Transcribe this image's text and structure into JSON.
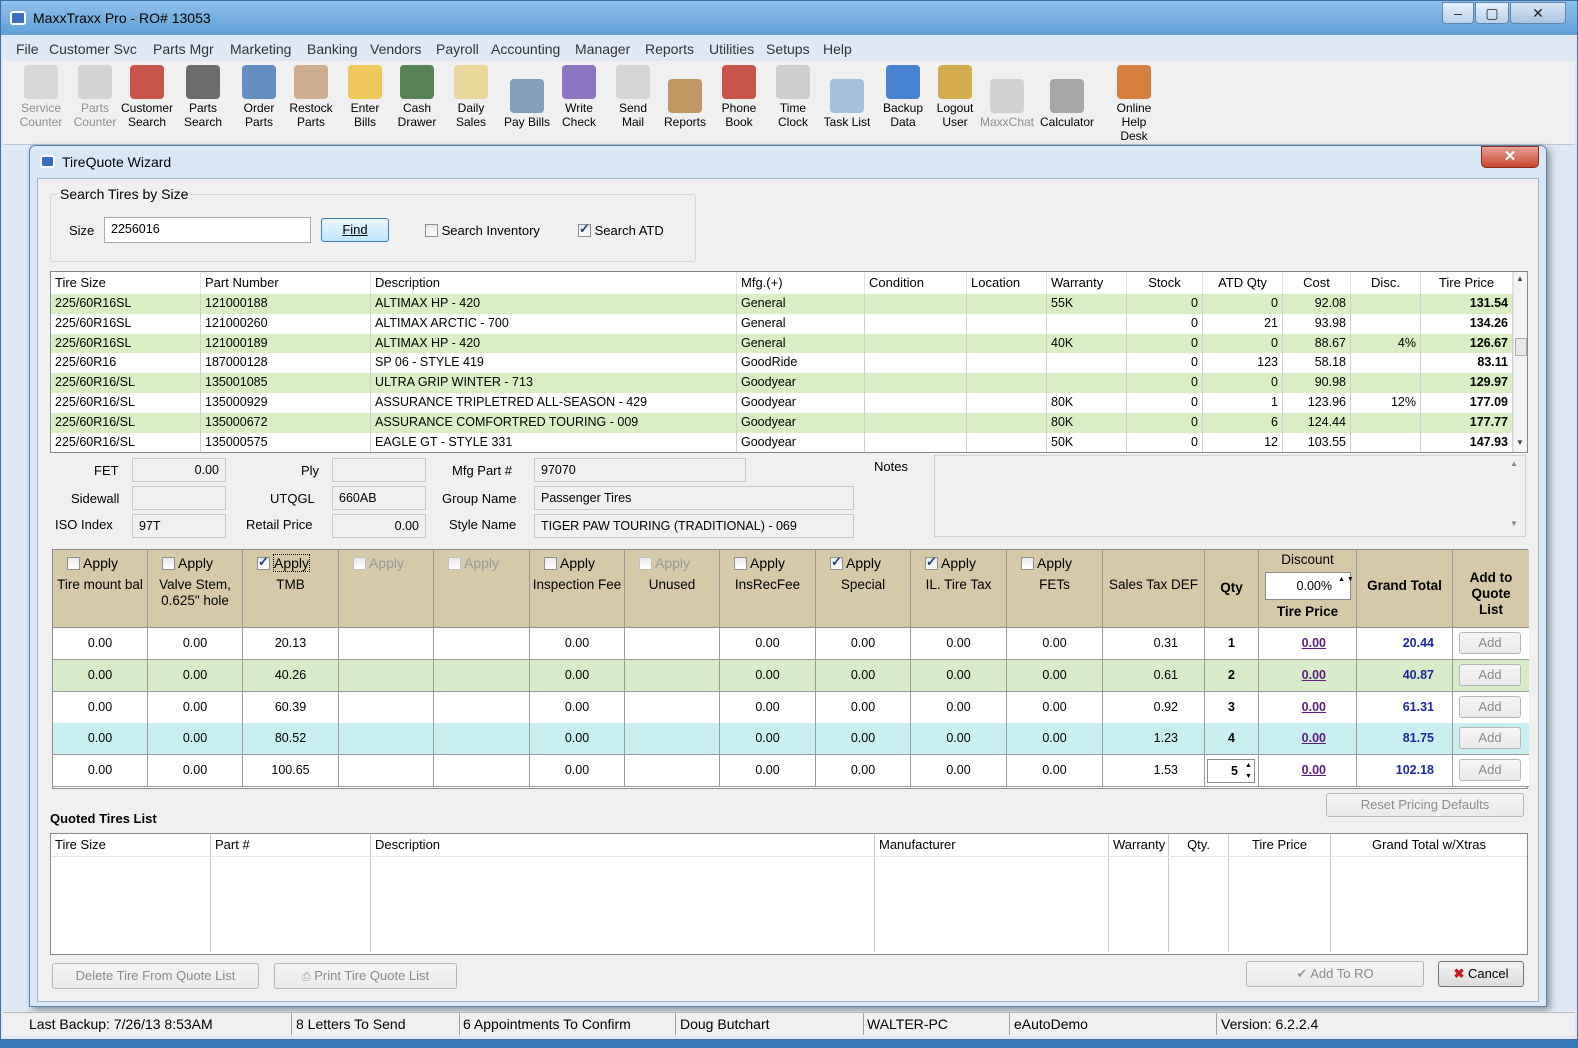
{
  "window": {
    "title": "MaxxTraxx Pro  - RO# 13053"
  },
  "menu": [
    "File",
    "Customer Svc",
    "Parts Mgr",
    "Marketing",
    "Banking",
    "Vendors",
    "Payroll",
    "Accounting",
    "Manager",
    "Reports",
    "Utilities",
    "Setups",
    "Help"
  ],
  "toolbar": [
    {
      "label": "Service\nCounter",
      "icon": "service-counter-icon",
      "enabled": false
    },
    {
      "label": "Parts\nCounter",
      "icon": "parts-counter-icon",
      "enabled": false
    },
    {
      "label": "Customer\nSearch",
      "icon": "car-icon",
      "enabled": true
    },
    {
      "label": "Parts\nSearch",
      "icon": "tire-icon",
      "enabled": true
    },
    {
      "label": "Order\nParts",
      "icon": "order-icon",
      "enabled": true
    },
    {
      "label": "Restock\nParts",
      "icon": "clipboard-icon",
      "enabled": true
    },
    {
      "label": "Enter\nBills",
      "icon": "bills-icon",
      "enabled": true
    },
    {
      "label": "Cash\nDrawer",
      "icon": "money-bag-icon",
      "enabled": true
    },
    {
      "label": "Daily\nSales",
      "icon": "notepad-icon",
      "enabled": true
    },
    {
      "label": "Pay Bills",
      "icon": "register-icon",
      "enabled": true
    },
    {
      "label": "Write\nCheck",
      "icon": "check-icon",
      "enabled": true
    },
    {
      "label": "Send\nMail",
      "icon": "mail-icon",
      "enabled": true
    },
    {
      "label": "Reports",
      "icon": "reports-icon",
      "enabled": true
    },
    {
      "label": "Phone\nBook",
      "icon": "phone-icon",
      "enabled": true
    },
    {
      "label": "Time\nClock",
      "icon": "clock-icon",
      "enabled": true
    },
    {
      "label": "Task List",
      "icon": "task-list-icon",
      "enabled": true
    },
    {
      "label": "Backup\nData",
      "icon": "floppy-icon",
      "enabled": true
    },
    {
      "label": "Logout\nUser",
      "icon": "logout-icon",
      "enabled": true
    },
    {
      "label": "MaxxChat",
      "icon": "chat-icon",
      "enabled": false
    },
    {
      "label": "Calculator",
      "icon": "calculator-icon",
      "enabled": true
    },
    {
      "label": "Online\nHelp\nDesk",
      "icon": "help-desk-icon",
      "enabled": true
    }
  ],
  "dialog": {
    "title": "TireQuote Wizard",
    "search": {
      "group_label": "Search Tires by Size",
      "size_label": "Size",
      "size_value": "2256016",
      "find_label": "Find",
      "search_inventory_label": "Search Inventory",
      "search_inventory_checked": false,
      "search_atd_label": "Search ATD",
      "search_atd_checked": true
    },
    "tire_grid": {
      "columns": [
        "Tire Size",
        "Part Number",
        "Description",
        "Mfg.(+)",
        "Condition",
        "Location",
        "Warranty",
        "Stock",
        "ATD Qty",
        "Cost",
        "Disc.",
        "Tire Price"
      ],
      "rows": [
        [
          "225/60R16SL",
          "121000188",
          "ALTIMAX HP - 420",
          "General",
          "",
          "",
          "55K",
          "0",
          "0",
          "92.08",
          "",
          "131.54"
        ],
        [
          "225/60R16SL",
          "121000260",
          "ALTIMAX ARCTIC - 700",
          "General",
          "",
          "",
          "",
          "0",
          "21",
          "93.98",
          "",
          "134.26"
        ],
        [
          "225/60R16SL",
          "121000189",
          "ALTIMAX HP - 420",
          "General",
          "",
          "",
          "40K",
          "0",
          "0",
          "88.67",
          "4%",
          "126.67"
        ],
        [
          "225/60R16",
          "187000128",
          "SP 06 - STYLE 419",
          "GoodRide",
          "",
          "",
          "",
          "0",
          "123",
          "58.18",
          "",
          "83.11"
        ],
        [
          "225/60R16/SL",
          "135001085",
          "ULTRA GRIP WINTER - 713",
          "Goodyear",
          "",
          "",
          "",
          "0",
          "0",
          "90.98",
          "",
          "129.97"
        ],
        [
          "225/60R16/SL",
          "135000929",
          "ASSURANCE TRIPLETRED ALL-SEASON - 429",
          "Goodyear",
          "",
          "",
          "80K",
          "0",
          "1",
          "123.96",
          "12%",
          "177.09"
        ],
        [
          "225/60R16/SL",
          "135000672",
          "ASSURANCE COMFORTRED TOURING - 009",
          "Goodyear",
          "",
          "",
          "80K",
          "0",
          "6",
          "124.44",
          "",
          "177.77"
        ],
        [
          "225/60R16/SL",
          "135000575",
          "EAGLE GT - STYLE 331",
          "Goodyear",
          "",
          "",
          "50K",
          "0",
          "12",
          "103.55",
          "",
          "147.93"
        ]
      ]
    },
    "details": {
      "fet_label": "FET",
      "fet_value": "0.00",
      "ply_label": "Ply",
      "ply_value": "",
      "mfg_part_label": "Mfg Part #",
      "mfg_part_value": "97070",
      "sidewall_label": "Sidewall",
      "sidewall_value": "",
      "utqgl_label": "UTQGL",
      "utqgl_value": "660AB",
      "group_name_label": "Group Name",
      "group_name_value": "Passenger Tires",
      "iso_label": "ISO  Index",
      "iso_value": "97T",
      "retail_label": "Retail Price",
      "retail_value": "0.00",
      "style_label": "Style Name",
      "style_value": "TIGER PAW TOURING (TRADITIONAL) - 069",
      "notes_label": "Notes",
      "notes_value": ""
    },
    "pricing": {
      "apply_label": "Apply",
      "columns": [
        {
          "apply": true,
          "checked": false,
          "enabled": true,
          "label": "Tire mount bal"
        },
        {
          "apply": true,
          "checked": false,
          "enabled": true,
          "label": "Valve Stem, 0.625\" hole"
        },
        {
          "apply": true,
          "checked": true,
          "enabled": true,
          "label": "TMB"
        },
        {
          "apply": true,
          "checked": false,
          "enabled": false,
          "label": ""
        },
        {
          "apply": true,
          "checked": false,
          "enabled": false,
          "label": ""
        },
        {
          "apply": true,
          "checked": false,
          "enabled": true,
          "label": "Inspection Fee"
        },
        {
          "apply": true,
          "checked": false,
          "enabled": false,
          "label": "Unused"
        },
        {
          "apply": true,
          "checked": false,
          "enabled": true,
          "label": "InsRecFee"
        },
        {
          "apply": true,
          "checked": true,
          "enabled": true,
          "label": "Special"
        },
        {
          "apply": true,
          "checked": true,
          "enabled": true,
          "label": "IL. Tire Tax"
        },
        {
          "apply": true,
          "checked": false,
          "enabled": true,
          "label": "FETs"
        },
        {
          "apply": false,
          "label": "Sales Tax DEF"
        }
      ],
      "qty_label": "Qty",
      "discount_label": "Discount",
      "discount_value": "0.00%",
      "tire_price_label": "Tire Price",
      "grand_total_label": "Grand Total",
      "add_to_quote_label": "Add to Quote List",
      "add_label": "Add",
      "rows": [
        {
          "vals": [
            "0.00",
            "0.00",
            "20.13",
            "",
            "",
            "0.00",
            "",
            "0.00",
            "0.00",
            "0.00",
            "0.00",
            "0.31"
          ],
          "qty": "1",
          "price": "0.00",
          "total": "20.44",
          "bg": "#ffffff"
        },
        {
          "vals": [
            "0.00",
            "0.00",
            "40.26",
            "",
            "",
            "0.00",
            "",
            "0.00",
            "0.00",
            "0.00",
            "0.00",
            "0.61"
          ],
          "qty": "2",
          "price": "0.00",
          "total": "40.87",
          "bg": "#d8ebc8"
        },
        {
          "vals": [
            "0.00",
            "0.00",
            "60.39",
            "",
            "",
            "0.00",
            "",
            "0.00",
            "0.00",
            "0.00",
            "0.00",
            "0.92"
          ],
          "qty": "3",
          "price": "0.00",
          "total": "61.31",
          "bg": "#ffffff"
        },
        {
          "vals": [
            "0.00",
            "0.00",
            "80.52",
            "",
            "",
            "0.00",
            "",
            "0.00",
            "0.00",
            "0.00",
            "0.00",
            "1.23"
          ],
          "qty": "4",
          "price": "0.00",
          "total": "81.75",
          "bg": "#c8f0f0"
        },
        {
          "vals": [
            "0.00",
            "0.00",
            "100.65",
            "",
            "",
            "0.00",
            "",
            "0.00",
            "0.00",
            "0.00",
            "0.00",
            "1.53"
          ],
          "qty": "5",
          "price": "0.00",
          "total": "102.18",
          "bg": "#ffffff",
          "qty_spinner": true
        }
      ]
    },
    "reset_label": "Reset Pricing Defaults",
    "quoted": {
      "title": "Quoted Tires List",
      "columns": [
        "Tire Size",
        "Part #",
        "Description",
        "Manufacturer",
        "Warranty",
        "Qty.",
        "Tire Price",
        "Grand Total w/Xtras"
      ]
    },
    "delete_label": "Delete Tire  From Quote List",
    "print_label": "Print Tire Quote List",
    "add_to_ro_label": "Add To RO",
    "cancel_label": "Cancel"
  },
  "statusbar": {
    "backup": "Last Backup:  7/26/13   8:53AM",
    "letters": "8 Letters To Send",
    "appointments": "6 Appointments To Confirm",
    "user": "Doug Butchart",
    "computer": "WALTER-PC",
    "database": "eAutoDemo",
    "version": "Version:  6.2.2.4"
  },
  "colors": {
    "row_green": "#d9efc3",
    "row_cyan": "#c8f0f0",
    "pricing_header": "#d6c9a8",
    "link": "#5a1d7e",
    "grand_total": "#1a2a9a",
    "title_bar": "#6aa6da"
  }
}
